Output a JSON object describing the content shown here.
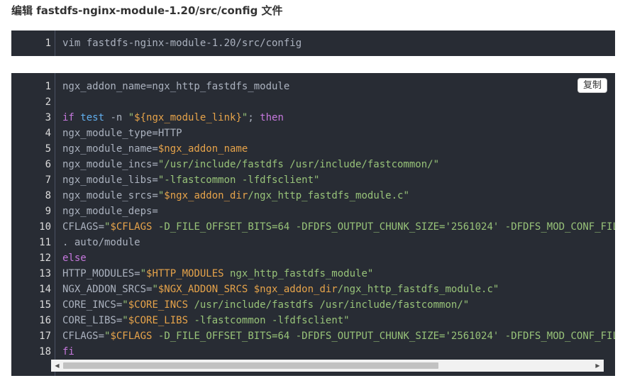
{
  "heading": "编辑 fastdfs-nginx-module-1.20/src/config 文件",
  "block1": {
    "line_numbers": [
      "1"
    ],
    "lines": [
      [
        {
          "t": "pl",
          "v": "vim fastdfs-nginx-module-1.20/src/config"
        }
      ]
    ]
  },
  "block2": {
    "copy_label": "复制",
    "line_numbers": [
      "1",
      "2",
      "3",
      "4",
      "5",
      "6",
      "7",
      "8",
      "9",
      "10",
      "11",
      "12",
      "13",
      "14",
      "15",
      "16",
      "17",
      "18"
    ],
    "lines": [
      [
        {
          "t": "pl",
          "v": "ngx_addon_name=ngx_http_fastdfs_module"
        }
      ],
      [],
      [
        {
          "t": "kw",
          "v": "if"
        },
        {
          "t": "pl",
          "v": " "
        },
        {
          "t": "fn",
          "v": "test"
        },
        {
          "t": "pl",
          "v": " -n "
        },
        {
          "t": "str",
          "v": "\""
        },
        {
          "t": "var",
          "v": "${ngx_module_link}"
        },
        {
          "t": "str",
          "v": "\""
        },
        {
          "t": "pl",
          "v": "; "
        },
        {
          "t": "kw",
          "v": "then"
        }
      ],
      [
        {
          "t": "pl",
          "v": "ngx_module_type="
        },
        {
          "t": "pl",
          "v": "HTTP"
        }
      ],
      [
        {
          "t": "pl",
          "v": "ngx_module_name="
        },
        {
          "t": "var",
          "v": "$ngx_addon_name"
        }
      ],
      [
        {
          "t": "pl",
          "v": "ngx_module_incs="
        },
        {
          "t": "str",
          "v": "\"/usr/include/fastdfs /usr/include/fastcommon/\""
        }
      ],
      [
        {
          "t": "pl",
          "v": "ngx_module_libs="
        },
        {
          "t": "str",
          "v": "\"-lfastcommon -lfdfsclient\""
        }
      ],
      [
        {
          "t": "pl",
          "v": "ngx_module_srcs="
        },
        {
          "t": "str",
          "v": "\""
        },
        {
          "t": "var",
          "v": "$ngx_addon_dir"
        },
        {
          "t": "str",
          "v": "/ngx_http_fastdfs_module.c\""
        }
      ],
      [
        {
          "t": "pl",
          "v": "ngx_module_deps="
        }
      ],
      [
        {
          "t": "pl",
          "v": "CFLAGS="
        },
        {
          "t": "str",
          "v": "\""
        },
        {
          "t": "var",
          "v": "$CFLAGS"
        },
        {
          "t": "str",
          "v": " -D_FILE_OFFSET_BITS=64 -DFDFS_OUTPUT_CHUNK_SIZE='2561024' -DFDFS_MOD_CONF_FIL"
        }
      ],
      [
        {
          "t": "pl",
          "v": ". auto/module"
        }
      ],
      [
        {
          "t": "kw",
          "v": "else"
        }
      ],
      [
        {
          "t": "pl",
          "v": "HTTP_MODULES="
        },
        {
          "t": "str",
          "v": "\""
        },
        {
          "t": "var",
          "v": "$HTTP_MODULES"
        },
        {
          "t": "str",
          "v": " ngx_http_fastdfs_module\""
        }
      ],
      [
        {
          "t": "pl",
          "v": "NGX_ADDON_SRCS="
        },
        {
          "t": "str",
          "v": "\""
        },
        {
          "t": "var",
          "v": "$NGX_ADDON_SRCS $ngx_addon_dir"
        },
        {
          "t": "str",
          "v": "/ngx_http_fastdfs_module.c\""
        }
      ],
      [
        {
          "t": "pl",
          "v": "CORE_INCS="
        },
        {
          "t": "str",
          "v": "\""
        },
        {
          "t": "var",
          "v": "$CORE_INCS"
        },
        {
          "t": "str",
          "v": " /usr/include/fastdfs /usr/include/fastcommon/\""
        }
      ],
      [
        {
          "t": "pl",
          "v": "CORE_LIBS="
        },
        {
          "t": "str",
          "v": "\""
        },
        {
          "t": "var",
          "v": "$CORE_LIBS"
        },
        {
          "t": "str",
          "v": " -lfastcommon -lfdfsclient\""
        }
      ],
      [
        {
          "t": "pl",
          "v": "CFLAGS="
        },
        {
          "t": "str",
          "v": "\""
        },
        {
          "t": "var",
          "v": "$CFLAGS"
        },
        {
          "t": "str",
          "v": " -D_FILE_OFFSET_BITS=64 -DFDFS_OUTPUT_CHUNK_SIZE='2561024' -DFDFS_MOD_CONF_FIL"
        }
      ],
      [
        {
          "t": "kw",
          "v": "fi"
        }
      ]
    ],
    "scroll_position": 0,
    "scroll_visible_fraction": 0.71
  },
  "colors": {
    "background": "#282c34",
    "keyword": "#c678dd",
    "function": "#61afef",
    "string": "#98c379",
    "variable": "#e6a34a",
    "plain": "#abb2bf"
  }
}
